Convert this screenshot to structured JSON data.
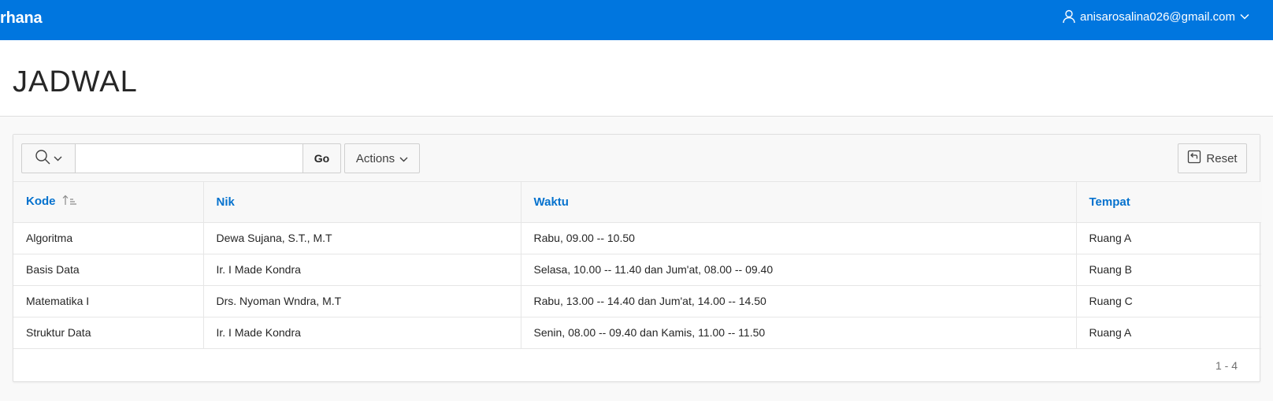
{
  "header": {
    "brand": "rhana",
    "user_email": "anisarosalina026@gmail.com",
    "user_icon": "user-icon",
    "menu_icon": "chevron-down-icon"
  },
  "page": {
    "title": "JADWAL"
  },
  "toolbar": {
    "search_icon": "search-icon",
    "search_value": "",
    "go_label": "Go",
    "actions_label": "Actions",
    "reset_label": "Reset",
    "reset_icon": "reset-icon"
  },
  "table": {
    "columns": [
      {
        "label": "Kode",
        "sorted": "ascending"
      },
      {
        "label": "Nik"
      },
      {
        "label": "Waktu"
      },
      {
        "label": "Tempat"
      }
    ],
    "rows": [
      [
        "Algoritma",
        "Dewa Sujana, S.T., M.T",
        "Rabu, 09.00 -- 10.50",
        "Ruang A"
      ],
      [
        "Basis Data",
        "Ir. I Made Kondra",
        "Selasa, 10.00 -- 11.40 dan Jum'at, 08.00 -- 09.40",
        "Ruang B"
      ],
      [
        "Matematika I",
        "Drs. Nyoman Wndra, M.T",
        "Rabu, 13.00 -- 14.40 dan Jum'at, 14.00 -- 14.50",
        "Ruang C"
      ],
      [
        "Struktur Data",
        "Ir. I Made Kondra",
        "Senin, 08.00 -- 09.40 dan Kamis, 11.00 -- 11.50",
        "Ruang A"
      ]
    ]
  },
  "pagination": {
    "range": "1 - 4"
  },
  "colors": {
    "header_bg": "#0076df",
    "link": "#0572ce"
  }
}
